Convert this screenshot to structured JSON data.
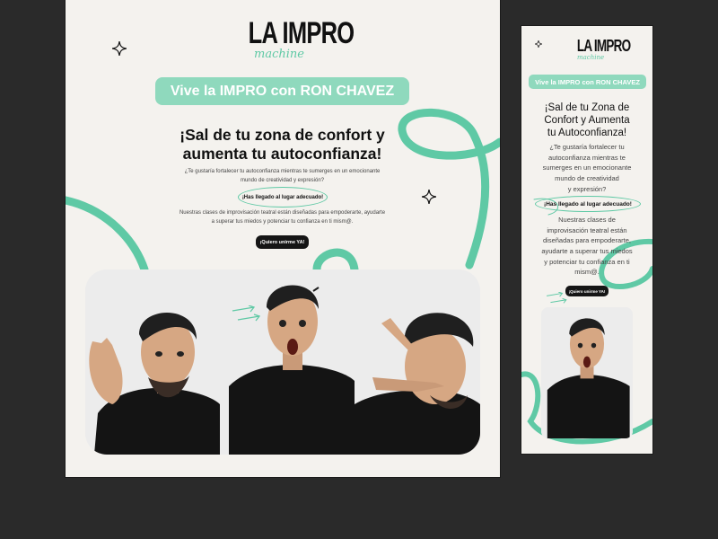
{
  "brand": {
    "logo_main": "LA IMPRO",
    "logo_sub": "machine"
  },
  "hero": {
    "banner": "Vive la IMPRO con RON CHAVEZ",
    "headline_line1": "¡Sal de tu zona de confort y",
    "headline_line2": "aumenta tu autoconfianza!",
    "question_line1": "¿Te gustaría fortalecer tu autoconfianza mientras te sumerges en un emocionante",
    "question_line2": "mundo de creatividad y expresión?",
    "highlight": "¡Has llegado al lugar adecuado!",
    "description_line1": "Nuestras clases de improvisación teatral están diseñadas para empoderarte, ayudarte",
    "description_line2": "a superar tus miedos y potenciar tu confianza en ti mism@.",
    "cta": "¡Quiero unirme YA!"
  },
  "mobile": {
    "banner": "Vive la IMPRO con RON CHAVEZ",
    "headline": [
      "¡Sal de tu Zona de",
      "Confort y Aumenta",
      "tu Autoconfianza!"
    ],
    "question": [
      "¿Te gustaría fortalecer tu",
      "autoconfianza mientras te",
      "sumerges en un emocionante",
      "mundo de creatividad",
      "y expresión?"
    ],
    "highlight": "¡Has llegado al lugar adecuado!",
    "description": [
      "Nuestras clases de",
      "improvisación teatral están",
      "diseñadas para empoderarte,",
      "ayudarte a superar tus miedos",
      "y potenciar tu confianza en ti",
      "mism@."
    ],
    "cta": "¡Quiero unirme YA!"
  },
  "colors": {
    "accent": "#5fc9a5",
    "banner_bg": "#8fd9bd",
    "page_bg": "#f4f2ee",
    "backdrop": "#2a2a2a",
    "cta_bg": "#151515"
  },
  "icons": [
    "sparkle-icon",
    "arrows-doodle-icon"
  ]
}
